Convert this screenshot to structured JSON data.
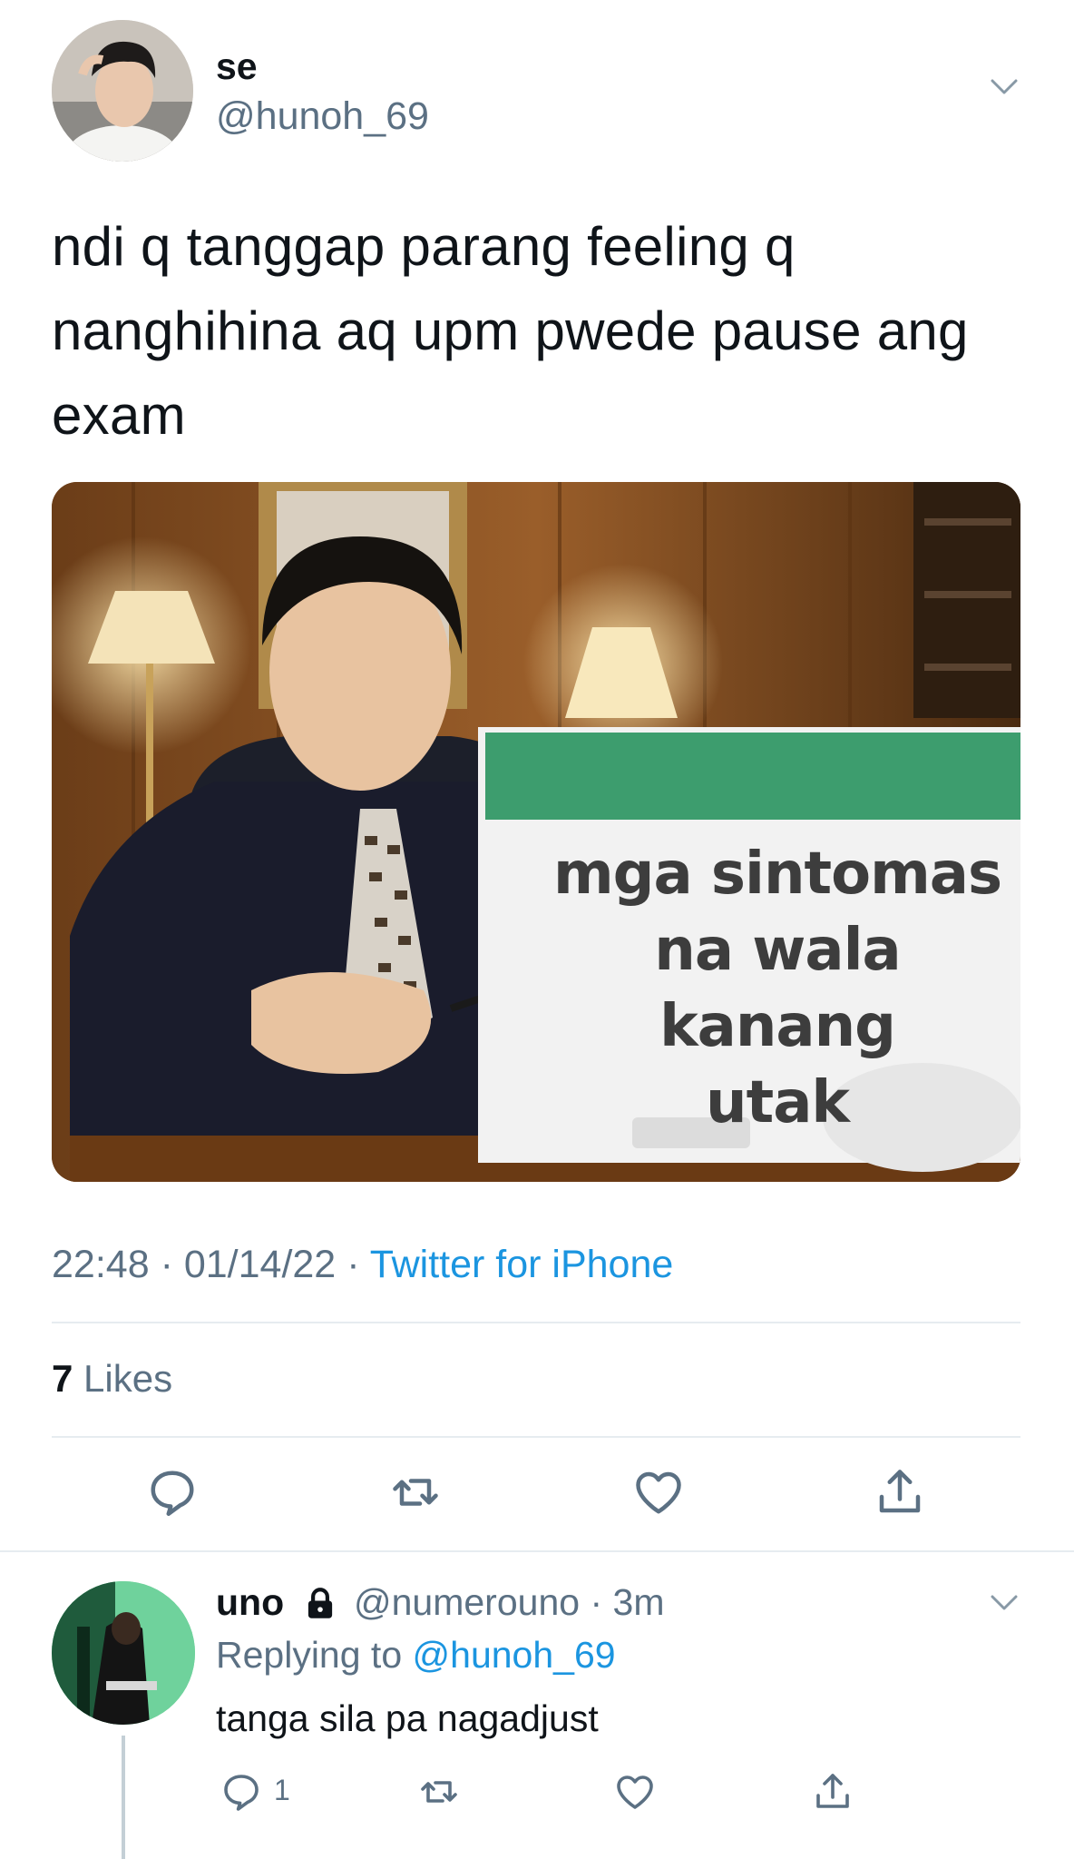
{
  "tweet": {
    "display_name": "se",
    "handle": "@hunoh_69",
    "text_lines": [
      "ndi q tanggap parang feeling q",
      "nanghihina aq upm pwede pause ang",
      "exam"
    ],
    "media": {
      "sign_lines": [
        "mga sintomas",
        "na wala kanang",
        "utak"
      ]
    },
    "time": "22:48",
    "date": "01/14/22",
    "separator": "·",
    "source": "Twitter for iPhone",
    "likes_count": "7",
    "likes_label": "Likes"
  },
  "reply": {
    "display_name": "uno",
    "handle": "@numerouno",
    "time_ago": "3m",
    "replying_prefix": "Replying to",
    "replying_to": "@hunoh_69",
    "text": "tanga sila pa nagadjust",
    "reply_count": "1"
  },
  "icons": {
    "caret": "chevron-down-icon",
    "reply": "reply-icon",
    "retweet": "retweet-icon",
    "like": "heart-icon",
    "share": "share-icon",
    "lock": "lock-icon"
  },
  "colors": {
    "link": "#1b95e0",
    "secondary": "#5b7083",
    "text": "#0f1419",
    "divider": "#e6ecf0"
  }
}
